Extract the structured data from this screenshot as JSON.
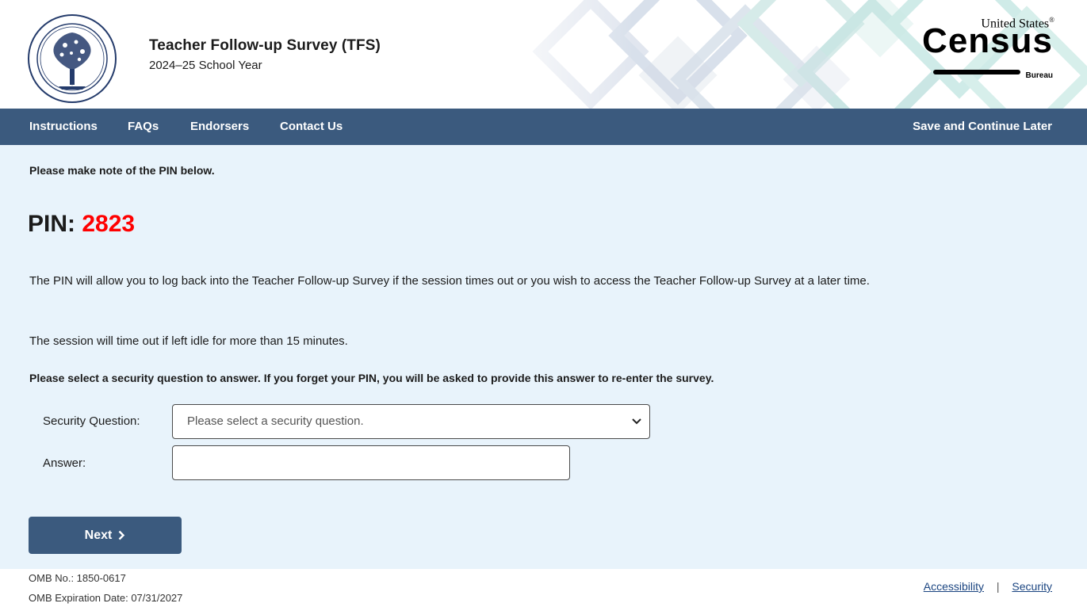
{
  "header": {
    "title": "Teacher Follow-up Survey (TFS)",
    "subtitle": "2024–25 School Year",
    "seal_icon": "department-of-education-seal-icon",
    "census_logo": {
      "top": "United States",
      "reg": "®",
      "word": "Census",
      "bottom": "Bureau"
    }
  },
  "nav": {
    "items": [
      "Instructions",
      "FAQs",
      "Endorsers",
      "Contact Us"
    ],
    "save_later": "Save and Continue Later"
  },
  "main": {
    "note": "Please make note of the PIN below.",
    "pin_label": "PIN:",
    "pin_value": "2823",
    "paragraph1": "The PIN will allow you to log back into the Teacher Follow-up Survey if the session times out or you wish to access the Teacher Follow-up Survey at a later time.",
    "paragraph2": "The session will time out if left idle for more than 15 minutes.",
    "instruction": "Please select a security question to answer. If you forget your PIN, you will be asked to provide this answer to re-enter the survey.",
    "security_question_label": "Security Question:",
    "security_question_value": "Please select a security question.",
    "answer_label": "Answer:",
    "answer_value": "",
    "next_label": "Next"
  },
  "footer": {
    "omb_number": "OMB No.: 1850-0617",
    "omb_expiration": "OMB Expiration Date: 07/31/2027",
    "accessibility": "Accessibility",
    "separator": "|",
    "security": "Security"
  },
  "colors": {
    "nav_bg": "#3b5a7e",
    "main_bg": "#e8f3fb",
    "pin_value": "#ff0000",
    "link": "#1a4480"
  }
}
